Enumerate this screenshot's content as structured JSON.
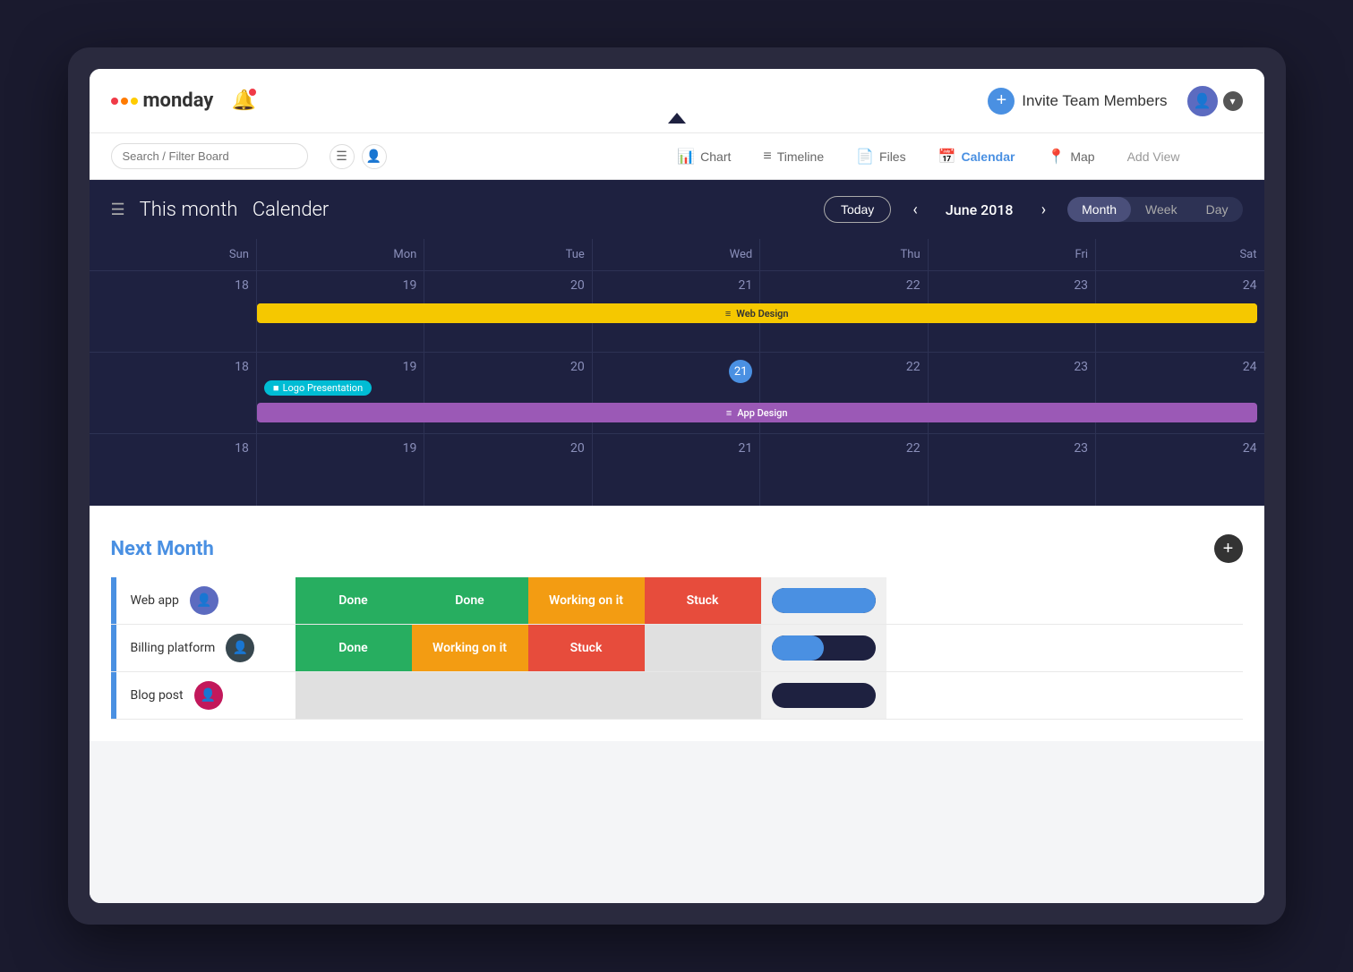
{
  "app": {
    "name": "monday",
    "notification_count": 1
  },
  "header": {
    "invite_label": "Invite Team Members",
    "search_placeholder": "Search / Filter Board"
  },
  "view_tabs": [
    {
      "id": "chart",
      "label": "Chart",
      "icon": "📊",
      "active": false
    },
    {
      "id": "timeline",
      "label": "Timeline",
      "icon": "📋",
      "active": false
    },
    {
      "id": "files",
      "label": "Files",
      "icon": "📄",
      "active": false
    },
    {
      "id": "calendar",
      "label": "Calendar",
      "icon": "📅",
      "active": true
    },
    {
      "id": "map",
      "label": "Map",
      "icon": "📍",
      "active": false
    }
  ],
  "add_view_label": "Add View",
  "calendar": {
    "title": "This month",
    "title_suffix": "Calender",
    "today_label": "Today",
    "month_year": "June 2018",
    "view_modes": [
      "Month",
      "Week",
      "Day"
    ],
    "active_view": "Month",
    "days": [
      "Sun",
      "Mon",
      "Tue",
      "Wed",
      "Thu",
      "Fri",
      "Sat"
    ],
    "week1_days": [
      18,
      19,
      20,
      21,
      22,
      23,
      24
    ],
    "week2_days": [
      18,
      19,
      20,
      21,
      22,
      23,
      24
    ],
    "week3_days": [
      18,
      19,
      20,
      21,
      22,
      23,
      24
    ],
    "events": {
      "web_design": "Web Design",
      "logo_presentation": "Logo Presentation",
      "app_design": "App Design"
    }
  },
  "next_month": {
    "title": "Next Month",
    "rows": [
      {
        "name": "Web app",
        "avatar_type": "male1",
        "statuses": [
          "Done",
          "Done",
          "Working on it",
          "Stuck"
        ],
        "progress": 100
      },
      {
        "name": "Billing platform",
        "avatar_type": "male2",
        "statuses": [
          "Done",
          "Working on it",
          "Stuck",
          ""
        ],
        "progress": 50
      },
      {
        "name": "Blog post",
        "avatar_type": "female1",
        "statuses": [
          "",
          "",
          "",
          ""
        ],
        "progress": 0
      }
    ]
  },
  "status_colors": {
    "done": "#27ae60",
    "working": "#f39c12",
    "stuck": "#e74c3c",
    "empty": "#e0e0e0"
  }
}
